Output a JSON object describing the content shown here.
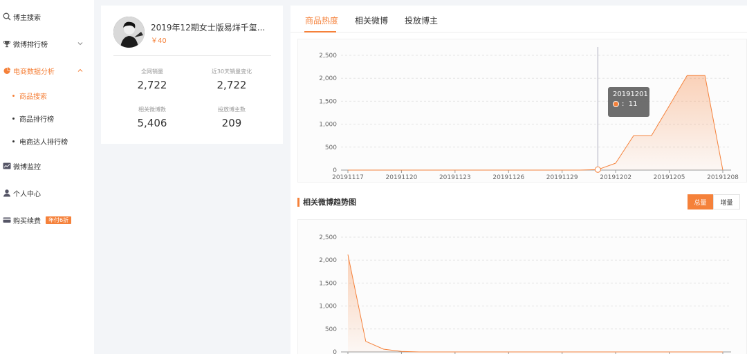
{
  "sidebar": {
    "items": [
      {
        "label": "博主搜索",
        "icon": "search-icon"
      },
      {
        "label": "微博排行榜",
        "icon": "trophy-icon"
      },
      {
        "label": "电商数据分析",
        "icon": "pie-chart-icon"
      },
      {
        "label": "微博监控",
        "icon": "line-chart-icon"
      },
      {
        "label": "个人中心",
        "icon": "user-icon"
      },
      {
        "label": "购买续费",
        "icon": "card-icon"
      }
    ],
    "subitems": [
      {
        "label": "商品搜索"
      },
      {
        "label": "商品排行榜"
      },
      {
        "label": "电商达人排行榜"
      }
    ],
    "promo_badge": "年付6折"
  },
  "product": {
    "title": "2019年12期女士版易烊千玺...",
    "price": "￥40",
    "stats": [
      {
        "label": "全网销量",
        "value": "2,722"
      },
      {
        "label": "近30天销量变化",
        "value": "2,722"
      },
      {
        "label": "相关微博数",
        "value": "5,406"
      },
      {
        "label": "投放博主数",
        "value": "209"
      }
    ]
  },
  "tabs": [
    "商品热度",
    "相关微博",
    "投放博主"
  ],
  "section": {
    "title": "相关微博趋势图",
    "toggle_on": "总量",
    "toggle_off": "增量"
  },
  "tooltip": {
    "date": "20191201",
    "value": "11"
  },
  "colors": {
    "accent": "#f5813a"
  },
  "chart_data": [
    {
      "type": "area",
      "y_ticks": [
        "0",
        "500",
        "1,000",
        "1,500",
        "2,000",
        "2,500"
      ],
      "x_tick_labels": [
        "20191117",
        "20191120",
        "20191123",
        "20191126",
        "20191129",
        "20191202",
        "20191205",
        "20191208"
      ],
      "x": [
        "20191117",
        "20191118",
        "20191119",
        "20191120",
        "20191121",
        "20191122",
        "20191123",
        "20191124",
        "20191125",
        "20191126",
        "20191127",
        "20191128",
        "20191129",
        "20191130",
        "20191201",
        "20191202",
        "20191203",
        "20191204",
        "20191205",
        "20191206",
        "20191207",
        "20191208"
      ],
      "values": [
        0,
        0,
        0,
        0,
        0,
        0,
        0,
        0,
        0,
        0,
        0,
        0,
        0,
        0,
        11,
        150,
        750,
        750,
        1400,
        2060,
        2060,
        0
      ],
      "ylim": [
        0,
        2500
      ],
      "grid": true,
      "highlight": "20191201"
    },
    {
      "type": "area",
      "y_ticks": [
        "0",
        "500",
        "1,000",
        "1,500",
        "2,000",
        "2,500"
      ],
      "values": [
        2120,
        230,
        60,
        10,
        0,
        0,
        0,
        0,
        0,
        0,
        0,
        0,
        0,
        0,
        0,
        0,
        0,
        0,
        0,
        0,
        0,
        0
      ],
      "ylim": [
        0,
        2500
      ],
      "grid": true
    }
  ]
}
